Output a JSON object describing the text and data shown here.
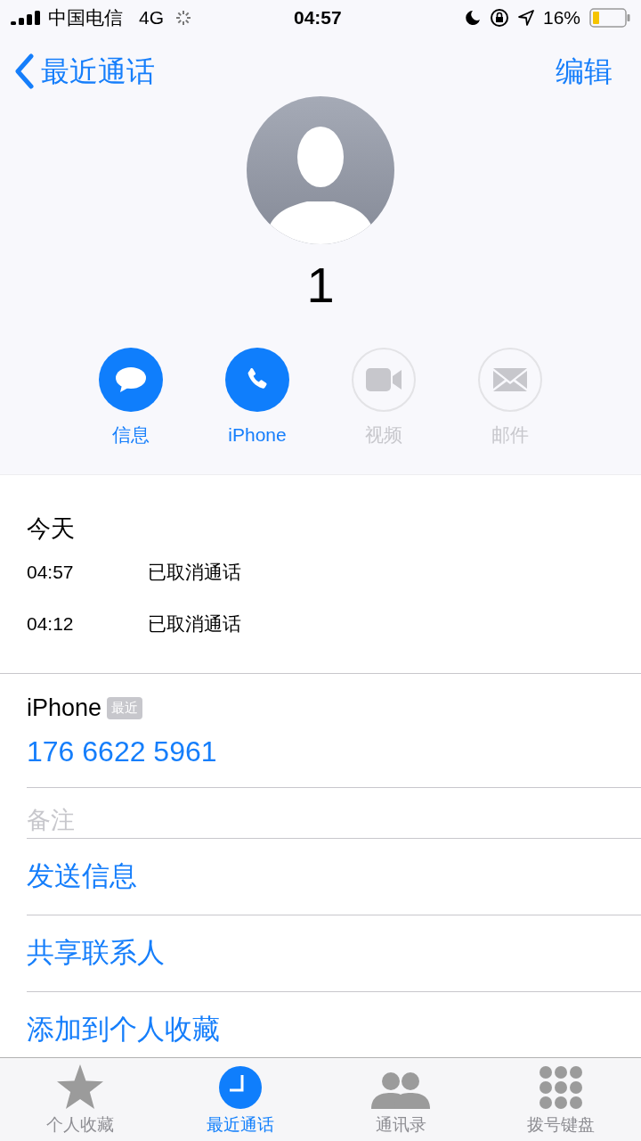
{
  "status_bar": {
    "carrier": "中国电信",
    "network": "4G",
    "time": "04:57",
    "battery": "16%"
  },
  "nav": {
    "back": "最近通话",
    "edit": "编辑"
  },
  "contact": {
    "name": "1"
  },
  "actions": [
    {
      "kind": "message",
      "label": "信息",
      "disabled": false
    },
    {
      "kind": "phone",
      "label": "iPhone",
      "disabled": false
    },
    {
      "kind": "video",
      "label": "视频",
      "disabled": true
    },
    {
      "kind": "mail",
      "label": "邮件",
      "disabled": true
    }
  ],
  "recents": {
    "heading": "今天",
    "calls": [
      {
        "time": "04:57",
        "status": "已取消通话"
      },
      {
        "time": "04:12",
        "status": "已取消通话"
      }
    ]
  },
  "phone": {
    "label": "iPhone",
    "badge": "最近",
    "number": "176 6622 5961"
  },
  "notes": {
    "placeholder": "备注"
  },
  "links": [
    "发送信息",
    "共享联系人",
    "添加到个人收藏"
  ],
  "tabs": [
    {
      "kind": "favorites",
      "label": "个人收藏",
      "selected": false
    },
    {
      "kind": "recents",
      "label": "最近通话",
      "selected": true
    },
    {
      "kind": "contacts",
      "label": "通讯录",
      "selected": false
    },
    {
      "kind": "keypad",
      "label": "拨号键盘",
      "selected": false
    }
  ]
}
